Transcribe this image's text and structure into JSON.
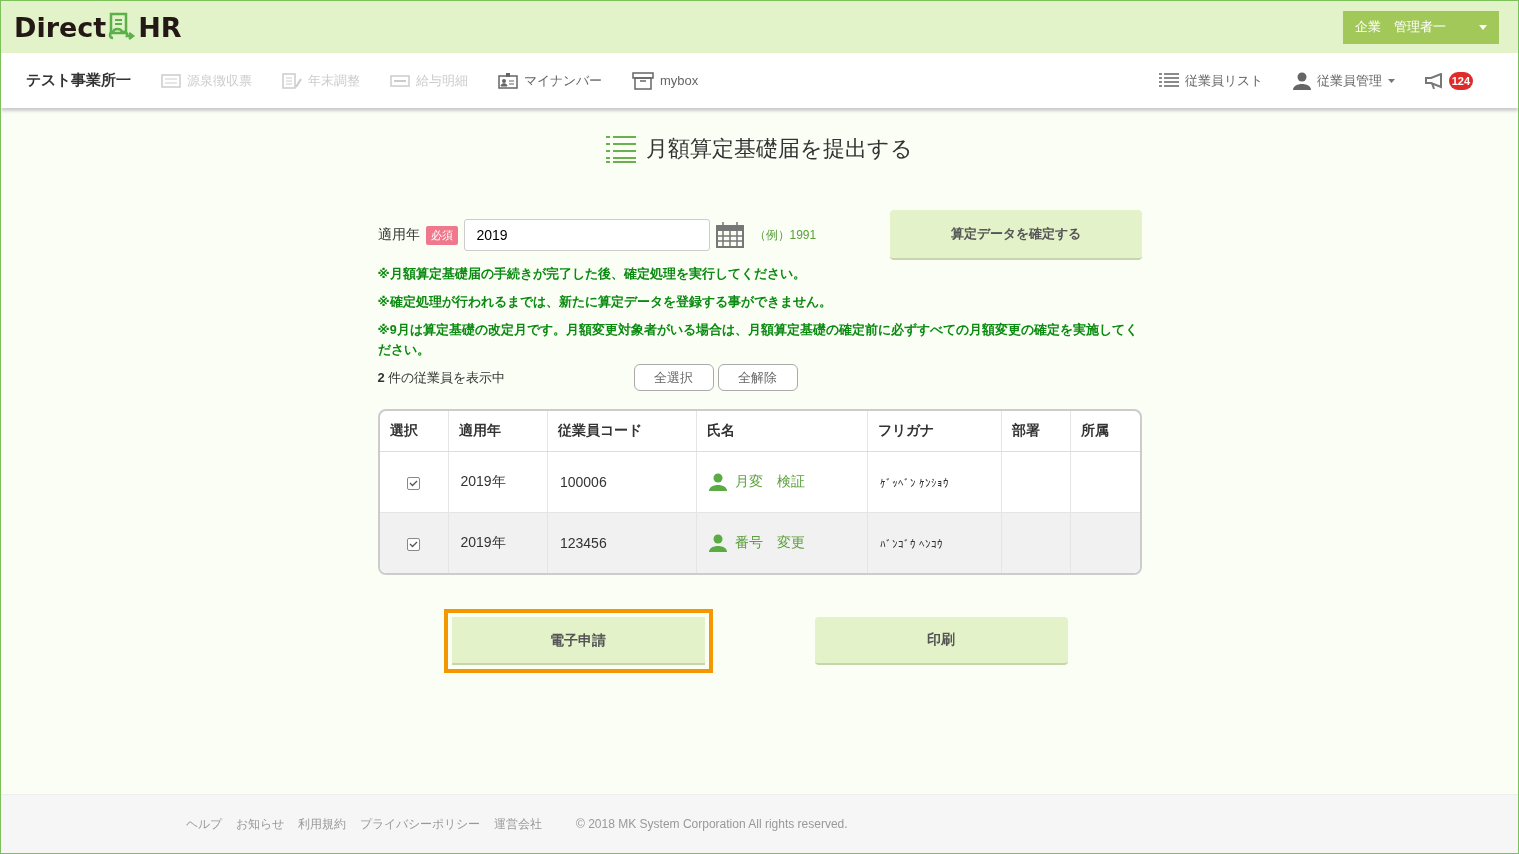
{
  "header": {
    "logo_left": "Direct",
    "logo_right": "HR",
    "user_menu": "企業　管理者一"
  },
  "nav": {
    "office": "テスト事業所一",
    "items": [
      {
        "label": "源泉徴収票",
        "kind": "slip",
        "disabled": true
      },
      {
        "label": "年末調整",
        "kind": "doc",
        "disabled": true
      },
      {
        "label": "給与明細",
        "kind": "card",
        "disabled": true
      },
      {
        "label": "マイナンバー",
        "kind": "id",
        "disabled": false
      },
      {
        "label": "mybox",
        "kind": "box",
        "disabled": false
      }
    ],
    "right": [
      {
        "label": "従業員リスト",
        "kind": "list",
        "dropdown": false
      },
      {
        "label": "従業員管理",
        "kind": "person",
        "dropdown": true
      }
    ],
    "notifications": "124"
  },
  "page_title": "月額算定基礎届を提出する",
  "form": {
    "label": "適用年",
    "required_badge": "必須",
    "value": "2019",
    "example": "（例）1991",
    "confirm_button": "算定データを確定する"
  },
  "notes": [
    "※月額算定基礎届の手続きが完了した後、確定処理を実行してください。",
    "※確定処理が行われるまでは、新たに算定データを登録する事ができません。",
    "※9月は算定基礎の改定月です。月額変更対象者がいる場合は、月額算定基礎の確定前に必ずすべての月額変更の確定を実施してください。"
  ],
  "count_text": "**2** 件の従業員を表示中",
  "select_all": "全選択",
  "clear_all": "全解除",
  "table": {
    "columns": [
      "選択",
      "適用年",
      "従業員コード",
      "氏名",
      "フリガナ",
      "部署",
      "所属"
    ],
    "rows": [
      {
        "checked": true,
        "year": "2019年",
        "code": "100006",
        "name": "月変　検証",
        "kana": "ｹﾞｯﾍﾞﾝ ｹﾝｼｮｳ"
      },
      {
        "checked": true,
        "year": "2019年",
        "code": "123456",
        "name": "番号　変更",
        "kana": "ﾊﾞﾝｺﾞｳ ﾍﾝｺｳ"
      }
    ]
  },
  "actions": [
    {
      "label": "電子申請",
      "highlighted": true
    },
    {
      "label": "印刷",
      "highlighted": false
    }
  ],
  "footer": {
    "links": [
      "ヘルプ",
      "お知らせ",
      "利用規約",
      "プライバシーポリシー",
      "運営会社"
    ],
    "copyright": "© 2018 MK System Corporation All rights reserved."
  }
}
